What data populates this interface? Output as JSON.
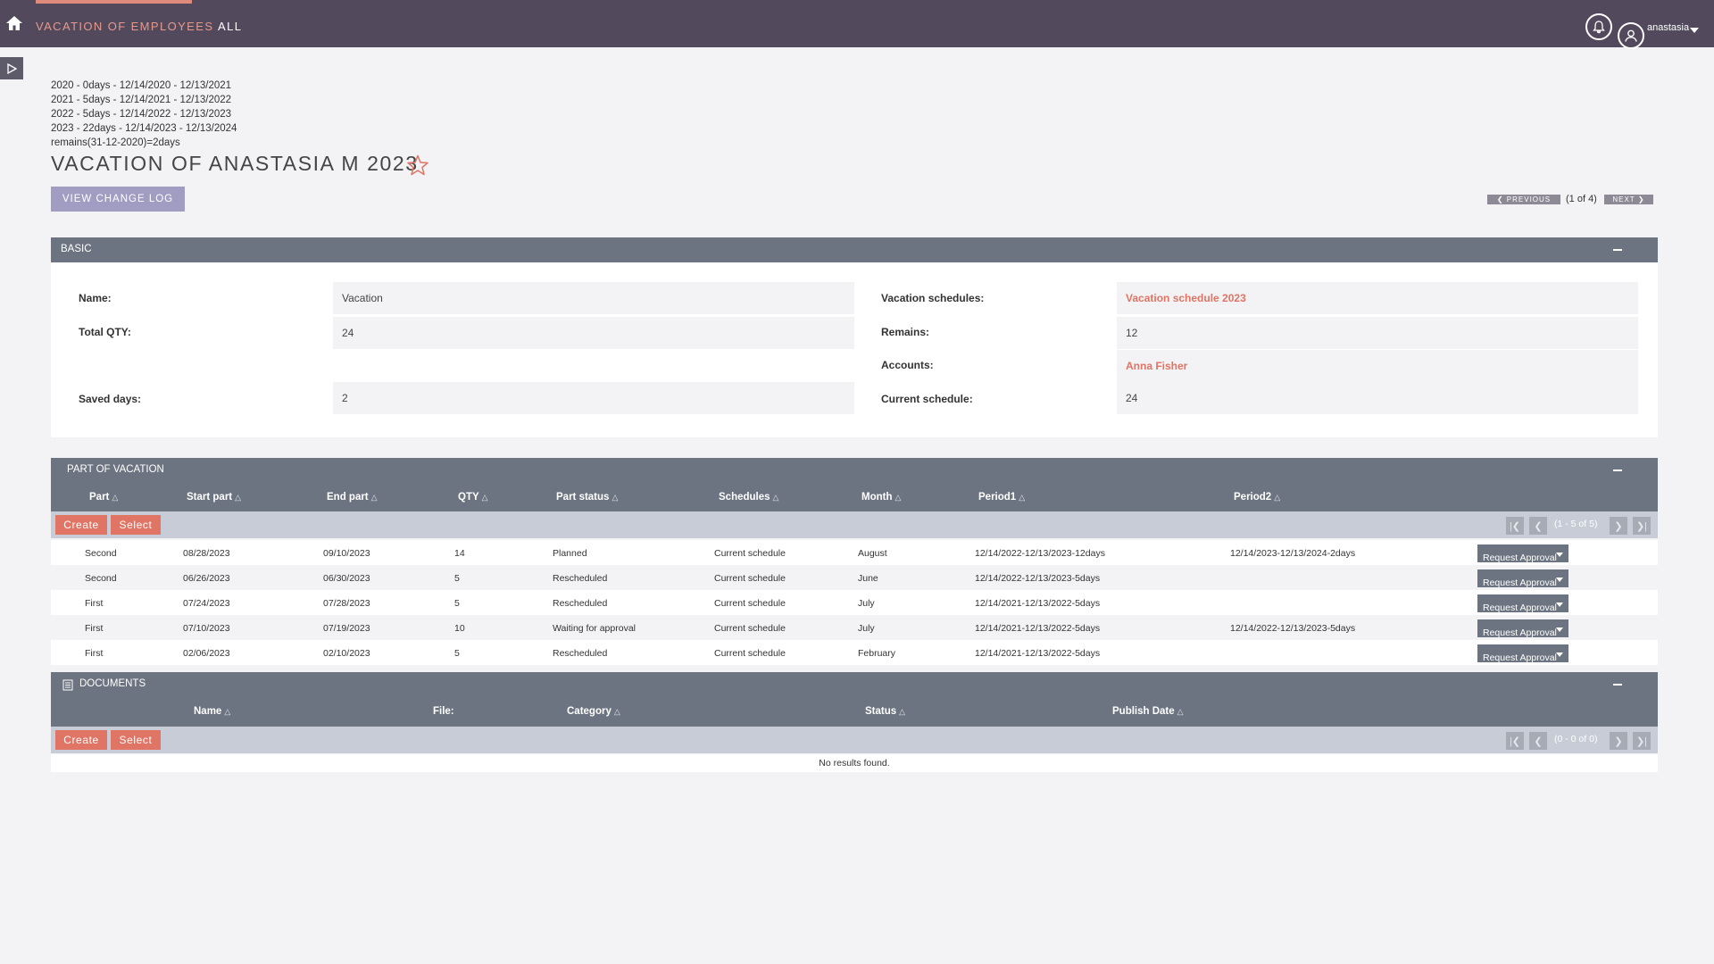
{
  "topbar": {
    "module_label": "VACATION OF EMPLOYEES",
    "all_label": "ALL",
    "user_name": "anastasia"
  },
  "info_lines": [
    "2020 - 0days - 12/14/2020 - 12/13/2021",
    "2021 - 5days - 12/14/2021 - 12/13/2022",
    "2022 - 5days - 12/14/2022 - 12/13/2023",
    "2023 - 22days - 12/14/2023 - 12/13/2024",
    "remains(31-12-2020)=2days"
  ],
  "page_title": "VACATION OF ANASTASIA M 2023",
  "change_log_label": "VIEW CHANGE LOG",
  "pagination": {
    "previous_label": "PREVIOUS",
    "next_label": "NEXT",
    "count": "(1 of 4)"
  },
  "basic": {
    "header": "BASIC",
    "name_label": "Name:",
    "name_value": "Vacation",
    "total_qty_label": "Total QTY:",
    "total_qty_value": "24",
    "saved_days_label": "Saved days:",
    "saved_days_value": "2",
    "vacation_schedules_label": "Vacation schedules:",
    "vacation_schedules_value": "Vacation schedule 2023",
    "remains_label": "Remains:",
    "remains_value": "12",
    "accounts_label": "Accounts:",
    "accounts_value": "Anna Fisher",
    "current_schedule_label": "Current schedule:",
    "current_schedule_value": "24"
  },
  "parts": {
    "header": "PART OF VACATION",
    "columns": [
      "Part",
      "Start part",
      "End part",
      "QTY",
      "Part status",
      "Schedules",
      "Month",
      "Period1",
      "Period2"
    ],
    "create_label": "Create",
    "select_label": "Select",
    "range": "(1 - 5 of 5)",
    "request_label": "Request Approval",
    "rows": [
      {
        "part": "Second",
        "start": "08/28/2023",
        "end": "09/10/2023",
        "qty": "14",
        "status": "Planned",
        "schedule": "Current schedule",
        "month": "August",
        "period1": "12/14/2022-12/13/2023-12days",
        "period2": "12/14/2023-12/13/2024-2days"
      },
      {
        "part": "Second",
        "start": "06/26/2023",
        "end": "06/30/2023",
        "qty": "5",
        "status": "Rescheduled",
        "schedule": "Current schedule",
        "month": "June",
        "period1": "12/14/2022-12/13/2023-5days",
        "period2": ""
      },
      {
        "part": "First",
        "start": "07/24/2023",
        "end": "07/28/2023",
        "qty": "5",
        "status": "Rescheduled",
        "schedule": "Current schedule",
        "month": "July",
        "period1": "12/14/2021-12/13/2022-5days",
        "period2": ""
      },
      {
        "part": "First",
        "start": "07/10/2023",
        "end": "07/19/2023",
        "qty": "10",
        "status": "Waiting for approval",
        "schedule": "Current schedule",
        "month": "July",
        "period1": "12/14/2021-12/13/2022-5days",
        "period2": "12/14/2022-12/13/2023-5days"
      },
      {
        "part": "First",
        "start": "02/06/2023",
        "end": "02/10/2023",
        "qty": "5",
        "status": "Rescheduled",
        "schedule": "Current schedule",
        "month": "February",
        "period1": "12/14/2021-12/13/2022-5days",
        "period2": ""
      }
    ]
  },
  "documents": {
    "header": "DOCUMENTS",
    "columns": [
      "Name",
      "File:",
      "Category",
      "Status",
      "Publish Date"
    ],
    "create_label": "Create",
    "select_label": "Select",
    "range": "(0 - 0 of 0)",
    "empty_message": "No results found."
  },
  "colors": {
    "topbar": "#524a5c",
    "accent": "#e07465",
    "panel_header": "#6c7481"
  }
}
